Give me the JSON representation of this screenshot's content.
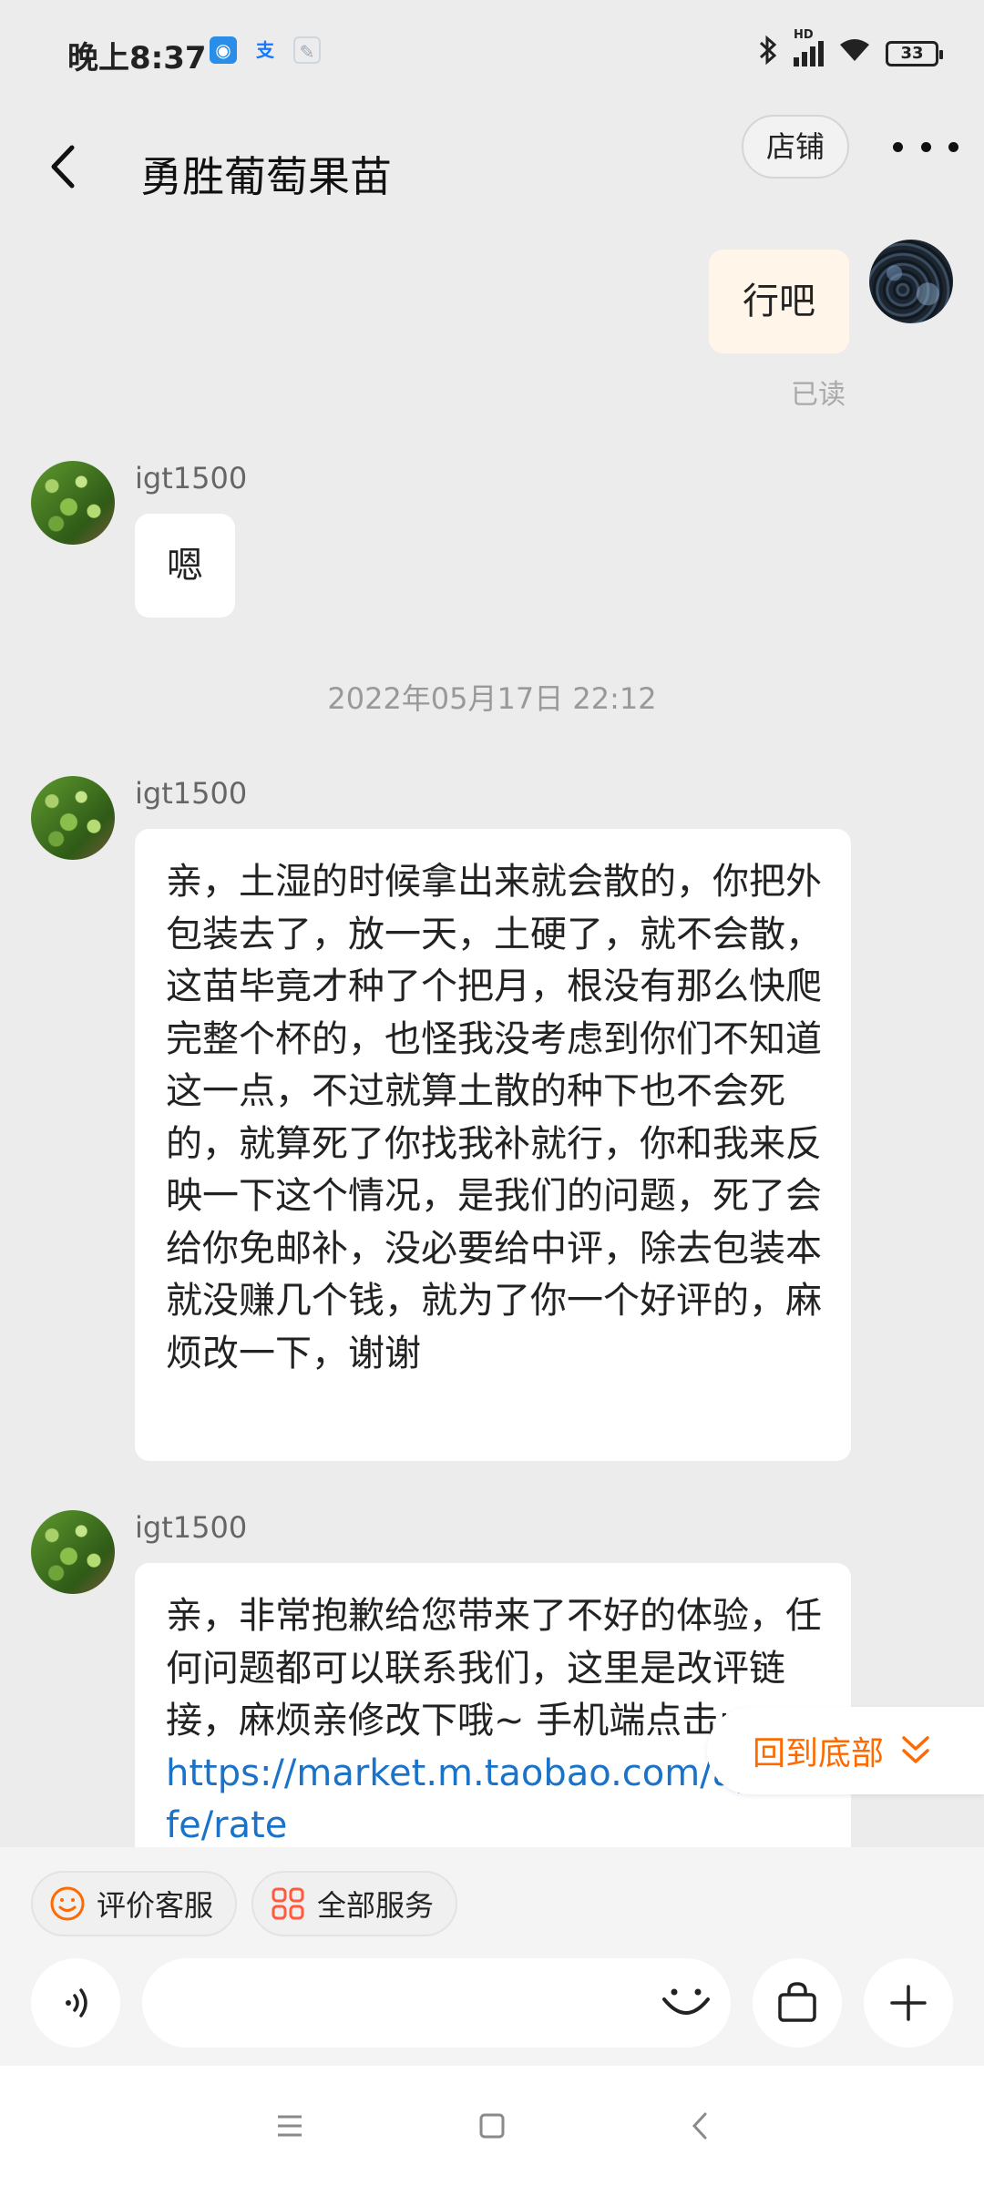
{
  "status_bar": {
    "time": "晚上8:37",
    "network": "HD",
    "battery": "33"
  },
  "header": {
    "title": "勇胜葡萄果苗",
    "store_label": "店铺"
  },
  "messages": {
    "m1": {
      "text": "行吧",
      "status": "已读"
    },
    "m2": {
      "sender": "igt1500",
      "text": "嗯"
    },
    "timestamp": "2022年05月17日 22:12",
    "m3": {
      "sender": "igt1500",
      "text": "亲，土湿的时候拿出来就会散的，你把外包装去了，放一天，土硬了，就不会散，这苗毕竟才种了个把月，根没有那么快爬完整个杯的，也怪我没考虑到你们不知道这一点，不过就算土散的种下也不会死的，就算死了你找我补就行，你和我来反映一下这个情况，是我们的问题，死了会给你免邮补，没必要给中评，除去包装本就没赚几个钱，就为了你一个好评的，麻烦改一下，谢谢"
    },
    "m4": {
      "sender": "igt1500",
      "text": "亲，非常抱歉给您带来了不好的体验，任何问题都可以联系我们，这里是改评链接，麻烦亲修改下哦~ 手机端点击: ",
      "link": "https://market.m.taobao.com/app/rate-fe/rate"
    }
  },
  "back_to_bottom": "回到底部",
  "quick_actions": {
    "rate_service": "评价客服",
    "all_services": "全部服务"
  },
  "input": {
    "value": "",
    "placeholder": ""
  },
  "colors": {
    "accent": "#ff6a00",
    "link": "#1a73c9",
    "my_bubble": "#fff6e9",
    "background": "#ececec"
  },
  "icons": [
    "back-arrow-icon",
    "more-icon",
    "smile-icon",
    "grid-icon",
    "voice-icon",
    "emoji-icon",
    "bag-icon",
    "plus-icon",
    "chevron-double-down-icon",
    "menu-icon",
    "home-icon",
    "nav-back-icon"
  ]
}
